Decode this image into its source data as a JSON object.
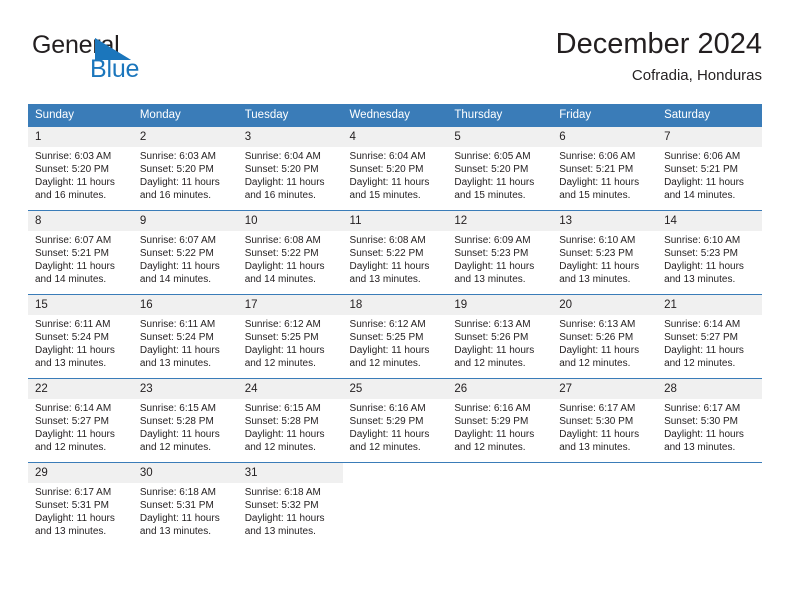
{
  "brand": {
    "name_part1": "General",
    "name_part2": "Blue",
    "triangle_color": "#1b76bc"
  },
  "header": {
    "title": "December 2024",
    "subtitle": "Cofradia, Honduras"
  },
  "theme": {
    "header_bg": "#3a7cb8",
    "daynum_bg": "#f0f0f0",
    "text": "#231f20",
    "accent": "#1b76bc"
  },
  "weekday_headers": [
    "Sunday",
    "Monday",
    "Tuesday",
    "Wednesday",
    "Thursday",
    "Friday",
    "Saturday"
  ],
  "weeks": [
    [
      {
        "day": "1",
        "sunrise": "Sunrise: 6:03 AM",
        "sunset": "Sunset: 5:20 PM",
        "daylight1": "Daylight: 11 hours",
        "daylight2": "and 16 minutes."
      },
      {
        "day": "2",
        "sunrise": "Sunrise: 6:03 AM",
        "sunset": "Sunset: 5:20 PM",
        "daylight1": "Daylight: 11 hours",
        "daylight2": "and 16 minutes."
      },
      {
        "day": "3",
        "sunrise": "Sunrise: 6:04 AM",
        "sunset": "Sunset: 5:20 PM",
        "daylight1": "Daylight: 11 hours",
        "daylight2": "and 16 minutes."
      },
      {
        "day": "4",
        "sunrise": "Sunrise: 6:04 AM",
        "sunset": "Sunset: 5:20 PM",
        "daylight1": "Daylight: 11 hours",
        "daylight2": "and 15 minutes."
      },
      {
        "day": "5",
        "sunrise": "Sunrise: 6:05 AM",
        "sunset": "Sunset: 5:20 PM",
        "daylight1": "Daylight: 11 hours",
        "daylight2": "and 15 minutes."
      },
      {
        "day": "6",
        "sunrise": "Sunrise: 6:06 AM",
        "sunset": "Sunset: 5:21 PM",
        "daylight1": "Daylight: 11 hours",
        "daylight2": "and 15 minutes."
      },
      {
        "day": "7",
        "sunrise": "Sunrise: 6:06 AM",
        "sunset": "Sunset: 5:21 PM",
        "daylight1": "Daylight: 11 hours",
        "daylight2": "and 14 minutes."
      }
    ],
    [
      {
        "day": "8",
        "sunrise": "Sunrise: 6:07 AM",
        "sunset": "Sunset: 5:21 PM",
        "daylight1": "Daylight: 11 hours",
        "daylight2": "and 14 minutes."
      },
      {
        "day": "9",
        "sunrise": "Sunrise: 6:07 AM",
        "sunset": "Sunset: 5:22 PM",
        "daylight1": "Daylight: 11 hours",
        "daylight2": "and 14 minutes."
      },
      {
        "day": "10",
        "sunrise": "Sunrise: 6:08 AM",
        "sunset": "Sunset: 5:22 PM",
        "daylight1": "Daylight: 11 hours",
        "daylight2": "and 14 minutes."
      },
      {
        "day": "11",
        "sunrise": "Sunrise: 6:08 AM",
        "sunset": "Sunset: 5:22 PM",
        "daylight1": "Daylight: 11 hours",
        "daylight2": "and 13 minutes."
      },
      {
        "day": "12",
        "sunrise": "Sunrise: 6:09 AM",
        "sunset": "Sunset: 5:23 PM",
        "daylight1": "Daylight: 11 hours",
        "daylight2": "and 13 minutes."
      },
      {
        "day": "13",
        "sunrise": "Sunrise: 6:10 AM",
        "sunset": "Sunset: 5:23 PM",
        "daylight1": "Daylight: 11 hours",
        "daylight2": "and 13 minutes."
      },
      {
        "day": "14",
        "sunrise": "Sunrise: 6:10 AM",
        "sunset": "Sunset: 5:23 PM",
        "daylight1": "Daylight: 11 hours",
        "daylight2": "and 13 minutes."
      }
    ],
    [
      {
        "day": "15",
        "sunrise": "Sunrise: 6:11 AM",
        "sunset": "Sunset: 5:24 PM",
        "daylight1": "Daylight: 11 hours",
        "daylight2": "and 13 minutes."
      },
      {
        "day": "16",
        "sunrise": "Sunrise: 6:11 AM",
        "sunset": "Sunset: 5:24 PM",
        "daylight1": "Daylight: 11 hours",
        "daylight2": "and 13 minutes."
      },
      {
        "day": "17",
        "sunrise": "Sunrise: 6:12 AM",
        "sunset": "Sunset: 5:25 PM",
        "daylight1": "Daylight: 11 hours",
        "daylight2": "and 12 minutes."
      },
      {
        "day": "18",
        "sunrise": "Sunrise: 6:12 AM",
        "sunset": "Sunset: 5:25 PM",
        "daylight1": "Daylight: 11 hours",
        "daylight2": "and 12 minutes."
      },
      {
        "day": "19",
        "sunrise": "Sunrise: 6:13 AM",
        "sunset": "Sunset: 5:26 PM",
        "daylight1": "Daylight: 11 hours",
        "daylight2": "and 12 minutes."
      },
      {
        "day": "20",
        "sunrise": "Sunrise: 6:13 AM",
        "sunset": "Sunset: 5:26 PM",
        "daylight1": "Daylight: 11 hours",
        "daylight2": "and 12 minutes."
      },
      {
        "day": "21",
        "sunrise": "Sunrise: 6:14 AM",
        "sunset": "Sunset: 5:27 PM",
        "daylight1": "Daylight: 11 hours",
        "daylight2": "and 12 minutes."
      }
    ],
    [
      {
        "day": "22",
        "sunrise": "Sunrise: 6:14 AM",
        "sunset": "Sunset: 5:27 PM",
        "daylight1": "Daylight: 11 hours",
        "daylight2": "and 12 minutes."
      },
      {
        "day": "23",
        "sunrise": "Sunrise: 6:15 AM",
        "sunset": "Sunset: 5:28 PM",
        "daylight1": "Daylight: 11 hours",
        "daylight2": "and 12 minutes."
      },
      {
        "day": "24",
        "sunrise": "Sunrise: 6:15 AM",
        "sunset": "Sunset: 5:28 PM",
        "daylight1": "Daylight: 11 hours",
        "daylight2": "and 12 minutes."
      },
      {
        "day": "25",
        "sunrise": "Sunrise: 6:16 AM",
        "sunset": "Sunset: 5:29 PM",
        "daylight1": "Daylight: 11 hours",
        "daylight2": "and 12 minutes."
      },
      {
        "day": "26",
        "sunrise": "Sunrise: 6:16 AM",
        "sunset": "Sunset: 5:29 PM",
        "daylight1": "Daylight: 11 hours",
        "daylight2": "and 12 minutes."
      },
      {
        "day": "27",
        "sunrise": "Sunrise: 6:17 AM",
        "sunset": "Sunset: 5:30 PM",
        "daylight1": "Daylight: 11 hours",
        "daylight2": "and 13 minutes."
      },
      {
        "day": "28",
        "sunrise": "Sunrise: 6:17 AM",
        "sunset": "Sunset: 5:30 PM",
        "daylight1": "Daylight: 11 hours",
        "daylight2": "and 13 minutes."
      }
    ],
    [
      {
        "day": "29",
        "sunrise": "Sunrise: 6:17 AM",
        "sunset": "Sunset: 5:31 PM",
        "daylight1": "Daylight: 11 hours",
        "daylight2": "and 13 minutes."
      },
      {
        "day": "30",
        "sunrise": "Sunrise: 6:18 AM",
        "sunset": "Sunset: 5:31 PM",
        "daylight1": "Daylight: 11 hours",
        "daylight2": "and 13 minutes."
      },
      {
        "day": "31",
        "sunrise": "Sunrise: 6:18 AM",
        "sunset": "Sunset: 5:32 PM",
        "daylight1": "Daylight: 11 hours",
        "daylight2": "and 13 minutes."
      },
      {
        "day": "",
        "sunrise": "",
        "sunset": "",
        "daylight1": "",
        "daylight2": ""
      },
      {
        "day": "",
        "sunrise": "",
        "sunset": "",
        "daylight1": "",
        "daylight2": ""
      },
      {
        "day": "",
        "sunrise": "",
        "sunset": "",
        "daylight1": "",
        "daylight2": ""
      },
      {
        "day": "",
        "sunrise": "",
        "sunset": "",
        "daylight1": "",
        "daylight2": ""
      }
    ]
  ]
}
